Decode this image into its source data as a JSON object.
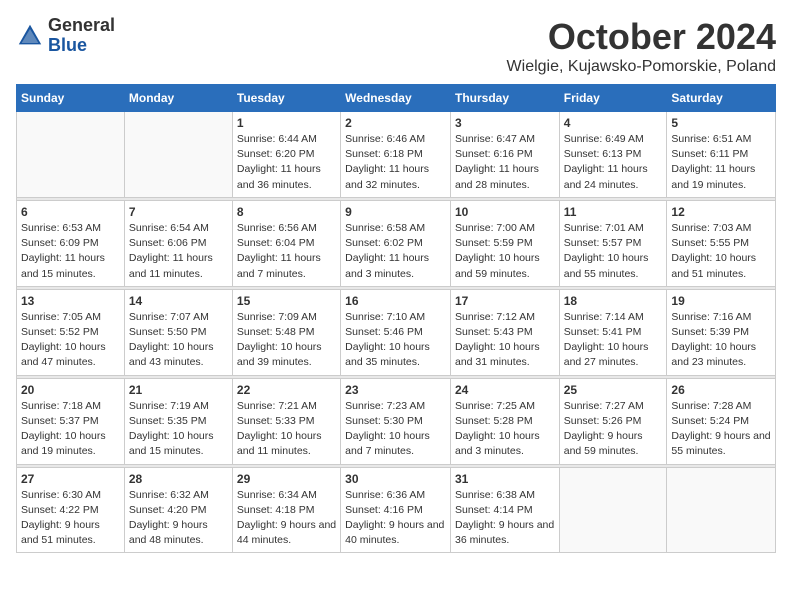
{
  "logo": {
    "general": "General",
    "blue": "Blue"
  },
  "title": "October 2024",
  "subtitle": "Wielgie, Kujawsko-Pomorskie, Poland",
  "weekdays": [
    "Sunday",
    "Monday",
    "Tuesday",
    "Wednesday",
    "Thursday",
    "Friday",
    "Saturday"
  ],
  "weeks": [
    [
      {
        "day": "",
        "info": ""
      },
      {
        "day": "",
        "info": ""
      },
      {
        "day": "1",
        "info": "Sunrise: 6:44 AM\nSunset: 6:20 PM\nDaylight: 11 hours\nand 36 minutes."
      },
      {
        "day": "2",
        "info": "Sunrise: 6:46 AM\nSunset: 6:18 PM\nDaylight: 11 hours\nand 32 minutes."
      },
      {
        "day": "3",
        "info": "Sunrise: 6:47 AM\nSunset: 6:16 PM\nDaylight: 11 hours\nand 28 minutes."
      },
      {
        "day": "4",
        "info": "Sunrise: 6:49 AM\nSunset: 6:13 PM\nDaylight: 11 hours\nand 24 minutes."
      },
      {
        "day": "5",
        "info": "Sunrise: 6:51 AM\nSunset: 6:11 PM\nDaylight: 11 hours\nand 19 minutes."
      }
    ],
    [
      {
        "day": "6",
        "info": "Sunrise: 6:53 AM\nSunset: 6:09 PM\nDaylight: 11 hours\nand 15 minutes."
      },
      {
        "day": "7",
        "info": "Sunrise: 6:54 AM\nSunset: 6:06 PM\nDaylight: 11 hours\nand 11 minutes."
      },
      {
        "day": "8",
        "info": "Sunrise: 6:56 AM\nSunset: 6:04 PM\nDaylight: 11 hours\nand 7 minutes."
      },
      {
        "day": "9",
        "info": "Sunrise: 6:58 AM\nSunset: 6:02 PM\nDaylight: 11 hours\nand 3 minutes."
      },
      {
        "day": "10",
        "info": "Sunrise: 7:00 AM\nSunset: 5:59 PM\nDaylight: 10 hours\nand 59 minutes."
      },
      {
        "day": "11",
        "info": "Sunrise: 7:01 AM\nSunset: 5:57 PM\nDaylight: 10 hours\nand 55 minutes."
      },
      {
        "day": "12",
        "info": "Sunrise: 7:03 AM\nSunset: 5:55 PM\nDaylight: 10 hours\nand 51 minutes."
      }
    ],
    [
      {
        "day": "13",
        "info": "Sunrise: 7:05 AM\nSunset: 5:52 PM\nDaylight: 10 hours\nand 47 minutes."
      },
      {
        "day": "14",
        "info": "Sunrise: 7:07 AM\nSunset: 5:50 PM\nDaylight: 10 hours\nand 43 minutes."
      },
      {
        "day": "15",
        "info": "Sunrise: 7:09 AM\nSunset: 5:48 PM\nDaylight: 10 hours\nand 39 minutes."
      },
      {
        "day": "16",
        "info": "Sunrise: 7:10 AM\nSunset: 5:46 PM\nDaylight: 10 hours\nand 35 minutes."
      },
      {
        "day": "17",
        "info": "Sunrise: 7:12 AM\nSunset: 5:43 PM\nDaylight: 10 hours\nand 31 minutes."
      },
      {
        "day": "18",
        "info": "Sunrise: 7:14 AM\nSunset: 5:41 PM\nDaylight: 10 hours\nand 27 minutes."
      },
      {
        "day": "19",
        "info": "Sunrise: 7:16 AM\nSunset: 5:39 PM\nDaylight: 10 hours\nand 23 minutes."
      }
    ],
    [
      {
        "day": "20",
        "info": "Sunrise: 7:18 AM\nSunset: 5:37 PM\nDaylight: 10 hours\nand 19 minutes."
      },
      {
        "day": "21",
        "info": "Sunrise: 7:19 AM\nSunset: 5:35 PM\nDaylight: 10 hours\nand 15 minutes."
      },
      {
        "day": "22",
        "info": "Sunrise: 7:21 AM\nSunset: 5:33 PM\nDaylight: 10 hours\nand 11 minutes."
      },
      {
        "day": "23",
        "info": "Sunrise: 7:23 AM\nSunset: 5:30 PM\nDaylight: 10 hours\nand 7 minutes."
      },
      {
        "day": "24",
        "info": "Sunrise: 7:25 AM\nSunset: 5:28 PM\nDaylight: 10 hours\nand 3 minutes."
      },
      {
        "day": "25",
        "info": "Sunrise: 7:27 AM\nSunset: 5:26 PM\nDaylight: 9 hours\nand 59 minutes."
      },
      {
        "day": "26",
        "info": "Sunrise: 7:28 AM\nSunset: 5:24 PM\nDaylight: 9 hours\nand 55 minutes."
      }
    ],
    [
      {
        "day": "27",
        "info": "Sunrise: 6:30 AM\nSunset: 4:22 PM\nDaylight: 9 hours\nand 51 minutes."
      },
      {
        "day": "28",
        "info": "Sunrise: 6:32 AM\nSunset: 4:20 PM\nDaylight: 9 hours\nand 48 minutes."
      },
      {
        "day": "29",
        "info": "Sunrise: 6:34 AM\nSunset: 4:18 PM\nDaylight: 9 hours\nand 44 minutes."
      },
      {
        "day": "30",
        "info": "Sunrise: 6:36 AM\nSunset: 4:16 PM\nDaylight: 9 hours\nand 40 minutes."
      },
      {
        "day": "31",
        "info": "Sunrise: 6:38 AM\nSunset: 4:14 PM\nDaylight: 9 hours\nand 36 minutes."
      },
      {
        "day": "",
        "info": ""
      },
      {
        "day": "",
        "info": ""
      }
    ]
  ]
}
